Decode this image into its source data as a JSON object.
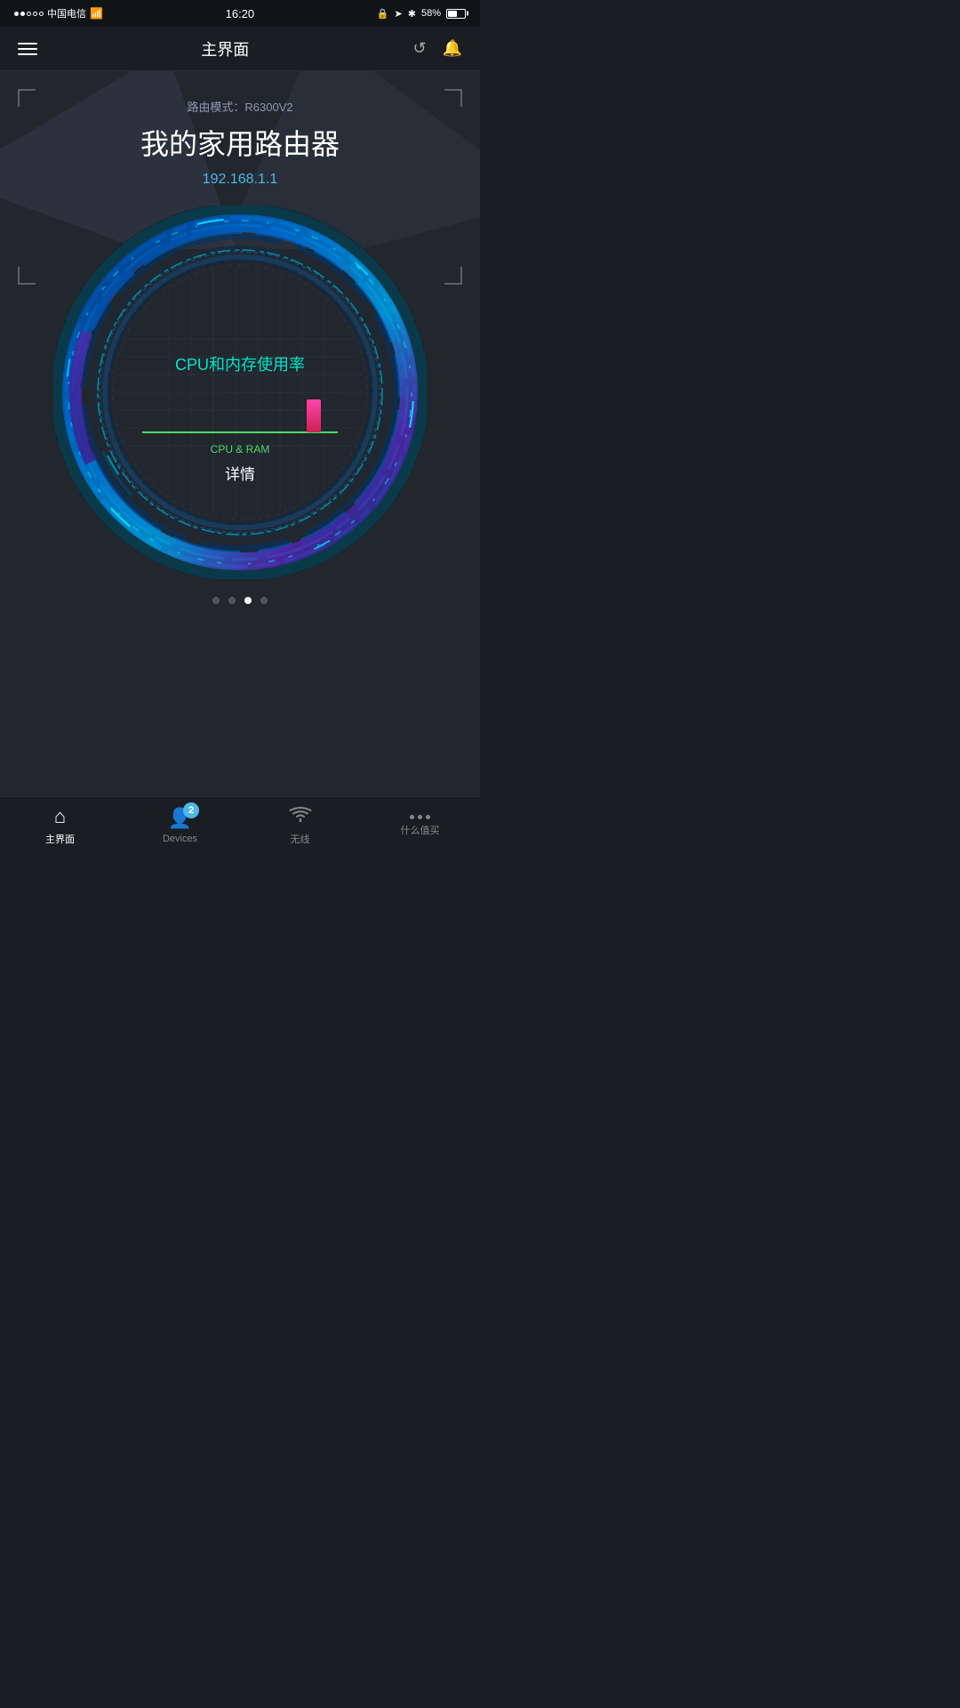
{
  "statusBar": {
    "carrier": "中国电信",
    "time": "16:20",
    "battery": "58%",
    "signalDots": [
      true,
      true,
      false,
      false,
      false
    ]
  },
  "navBar": {
    "title": "主界面",
    "menuIcon": "≡",
    "refreshIcon": "↺",
    "bellIcon": "🔔"
  },
  "router": {
    "modeLabel": "路由模式：R6300V2",
    "name": "我的家用路由器",
    "ip": "192.168.1.1"
  },
  "gauge": {
    "title": "CPU和内存使用率",
    "sublabel": "CPU & RAM",
    "detailsLabel": "详情"
  },
  "pageDots": {
    "count": 4,
    "activeIndex": 2
  },
  "tabBar": {
    "items": [
      {
        "id": "home",
        "label": "主界面",
        "icon": "house",
        "active": true,
        "badge": null
      },
      {
        "id": "devices",
        "label": "Devices",
        "icon": "person",
        "active": false,
        "badge": "2"
      },
      {
        "id": "wireless",
        "label": "无线",
        "icon": "wifi",
        "active": false,
        "badge": null
      },
      {
        "id": "more",
        "label": "什么值买",
        "icon": "dots",
        "active": false,
        "badge": null
      }
    ]
  }
}
